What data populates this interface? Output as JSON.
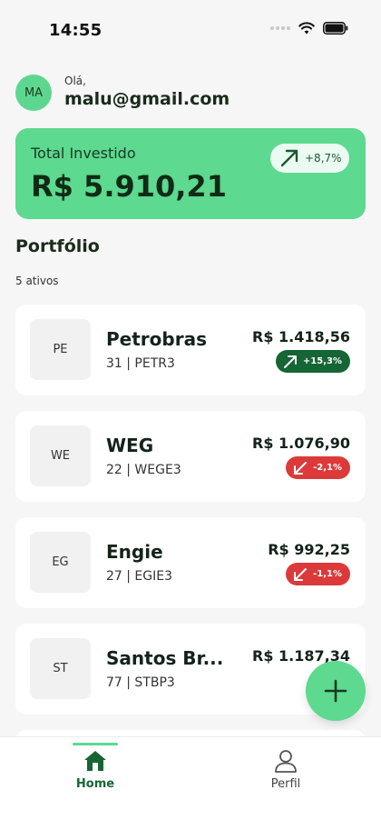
{
  "status_bar": {
    "time": "14:55"
  },
  "user": {
    "initials": "MA",
    "greeting": "Olá,",
    "email": "malu@gmail.com"
  },
  "summary": {
    "label": "Total Investido",
    "value": "R$ 5.910,21",
    "change": "+8,7%",
    "trend": "up"
  },
  "portfolio": {
    "title": "Portfólio",
    "count": "5 ativos",
    "assets": [
      {
        "initials": "PE",
        "name": "Petrobras",
        "detail": "31 | PETR3",
        "value": "R$ 1.418,56",
        "change": "+15,3%",
        "trend": "up"
      },
      {
        "initials": "WE",
        "name": "WEG",
        "detail": "22 | WEGE3",
        "value": "R$ 1.076,90",
        "change": "-2,1%",
        "trend": "down"
      },
      {
        "initials": "EG",
        "name": "Engie",
        "detail": "27 | EGIE3",
        "value": "R$ 992,25",
        "change": "-1,1%",
        "trend": "down"
      },
      {
        "initials": "ST",
        "name": "Santos Br...",
        "detail": "77 | STBP3",
        "value": "R$ 1.187,34",
        "change": "",
        "trend": "up"
      }
    ]
  },
  "fab": {
    "icon": "plus-icon"
  },
  "nav": {
    "home_label": "Home",
    "profile_label": "Perfil"
  },
  "colors": {
    "accent": "#5dd990",
    "positive": "#166534",
    "negative": "#dc3a3a",
    "background": "#f6f6f6"
  }
}
